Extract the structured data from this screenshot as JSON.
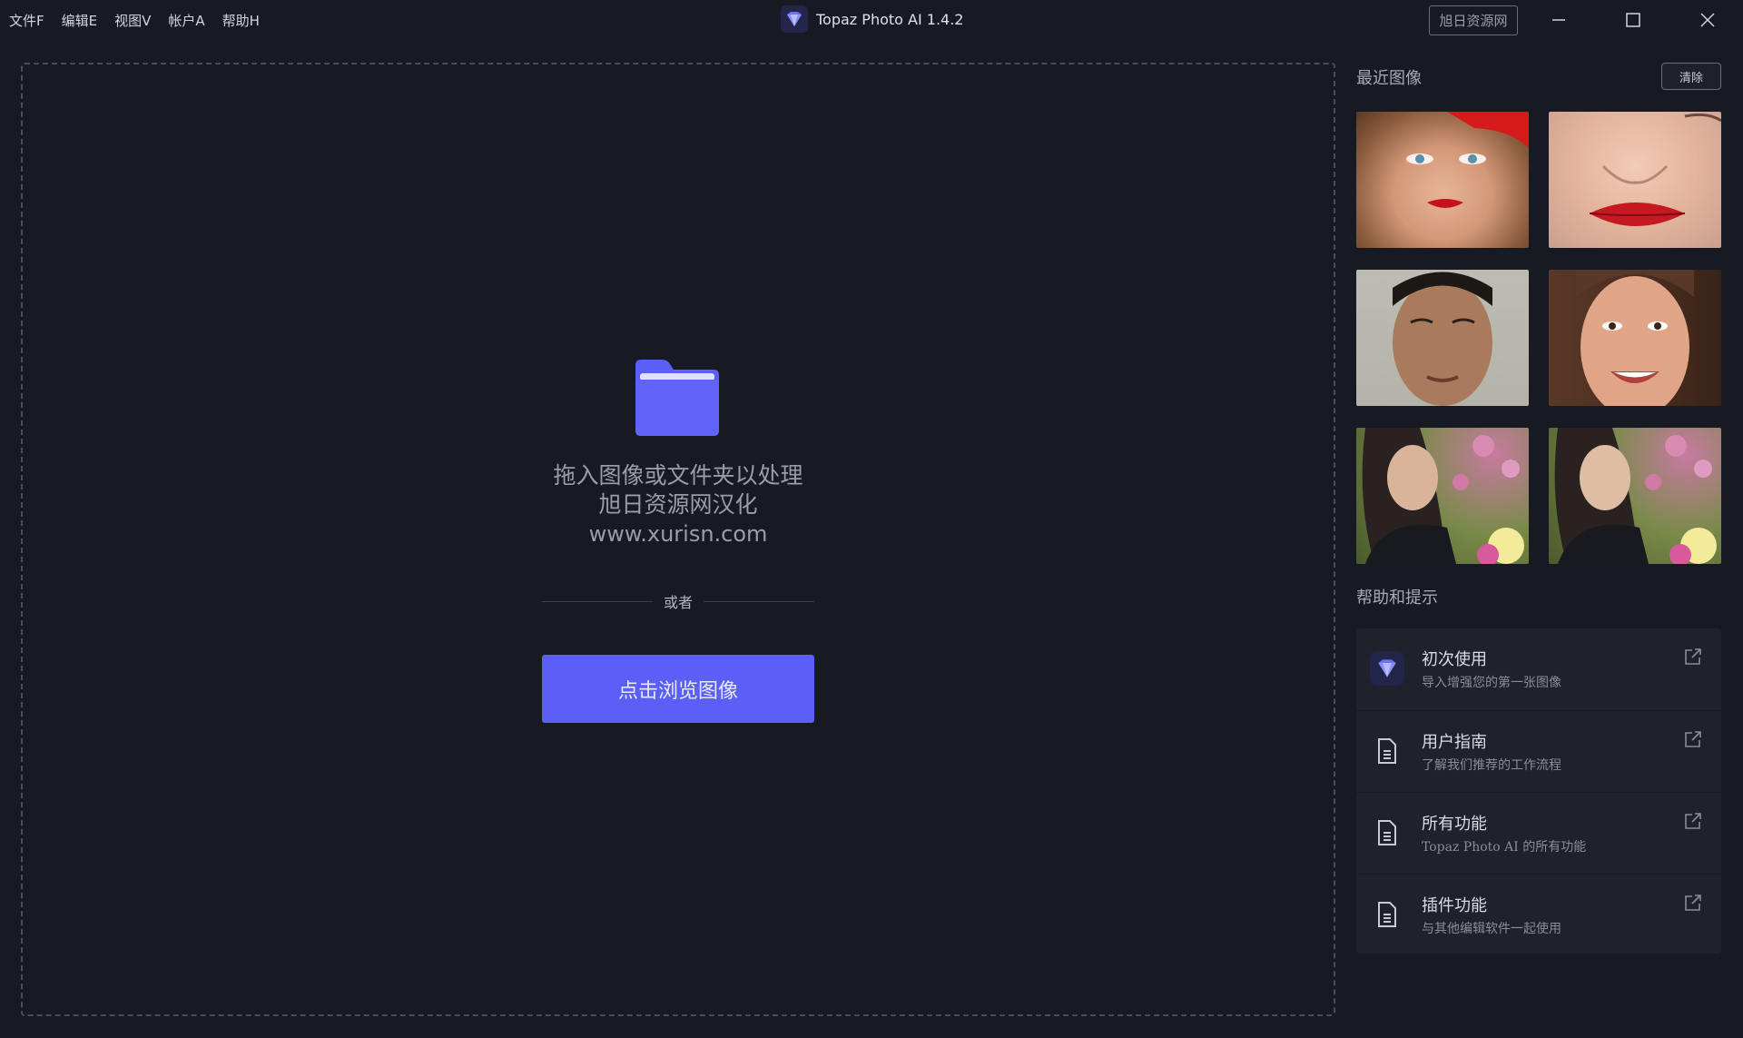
{
  "menu": [
    {
      "label": "文件F"
    },
    {
      "label": "编辑E"
    },
    {
      "label": "视图V"
    },
    {
      "label": "帐户A"
    },
    {
      "label": "帮助H"
    }
  ],
  "app": {
    "title": "Topaz Photo AI 1.4.2",
    "badge": "旭日资源网"
  },
  "window_controls": {
    "minimize": "minimize-icon",
    "maximize": "maximize-icon",
    "close": "close-icon"
  },
  "dropzone": {
    "icon": "folder-icon",
    "line1": "拖入图像或文件夹以处理",
    "line2": "旭日资源网汉化",
    "line3": "www.xurisn.com",
    "or_text": "或者",
    "browse_label": "点击浏览图像"
  },
  "recent": {
    "title": "最近图像",
    "clear_label": "清除",
    "thumbnails": [
      {
        "name": "woman-red-beret-portrait"
      },
      {
        "name": "red-lips-closeup"
      },
      {
        "name": "man-face-portrait"
      },
      {
        "name": "smiling-woman-portrait"
      },
      {
        "name": "woman-with-flowers-1"
      },
      {
        "name": "woman-with-flowers-2"
      }
    ]
  },
  "help": {
    "title": "帮助和提示",
    "items": [
      {
        "title": "初次使用",
        "subtitle": "导入增强您的第一张图像",
        "icon": "topaz-logo-icon"
      },
      {
        "title": "用户指南",
        "subtitle": "了解我们推荐的工作流程",
        "icon": "document-icon"
      },
      {
        "title": "所有功能",
        "subtitle": "Topaz Photo AI 的所有功能",
        "icon": "document-icon"
      },
      {
        "title": "插件功能",
        "subtitle": "与其他编辑软件一起使用",
        "icon": "document-icon"
      }
    ]
  },
  "colors": {
    "background": "#181a23",
    "accent": "#5b5ff5",
    "panel": "#1f212b"
  }
}
